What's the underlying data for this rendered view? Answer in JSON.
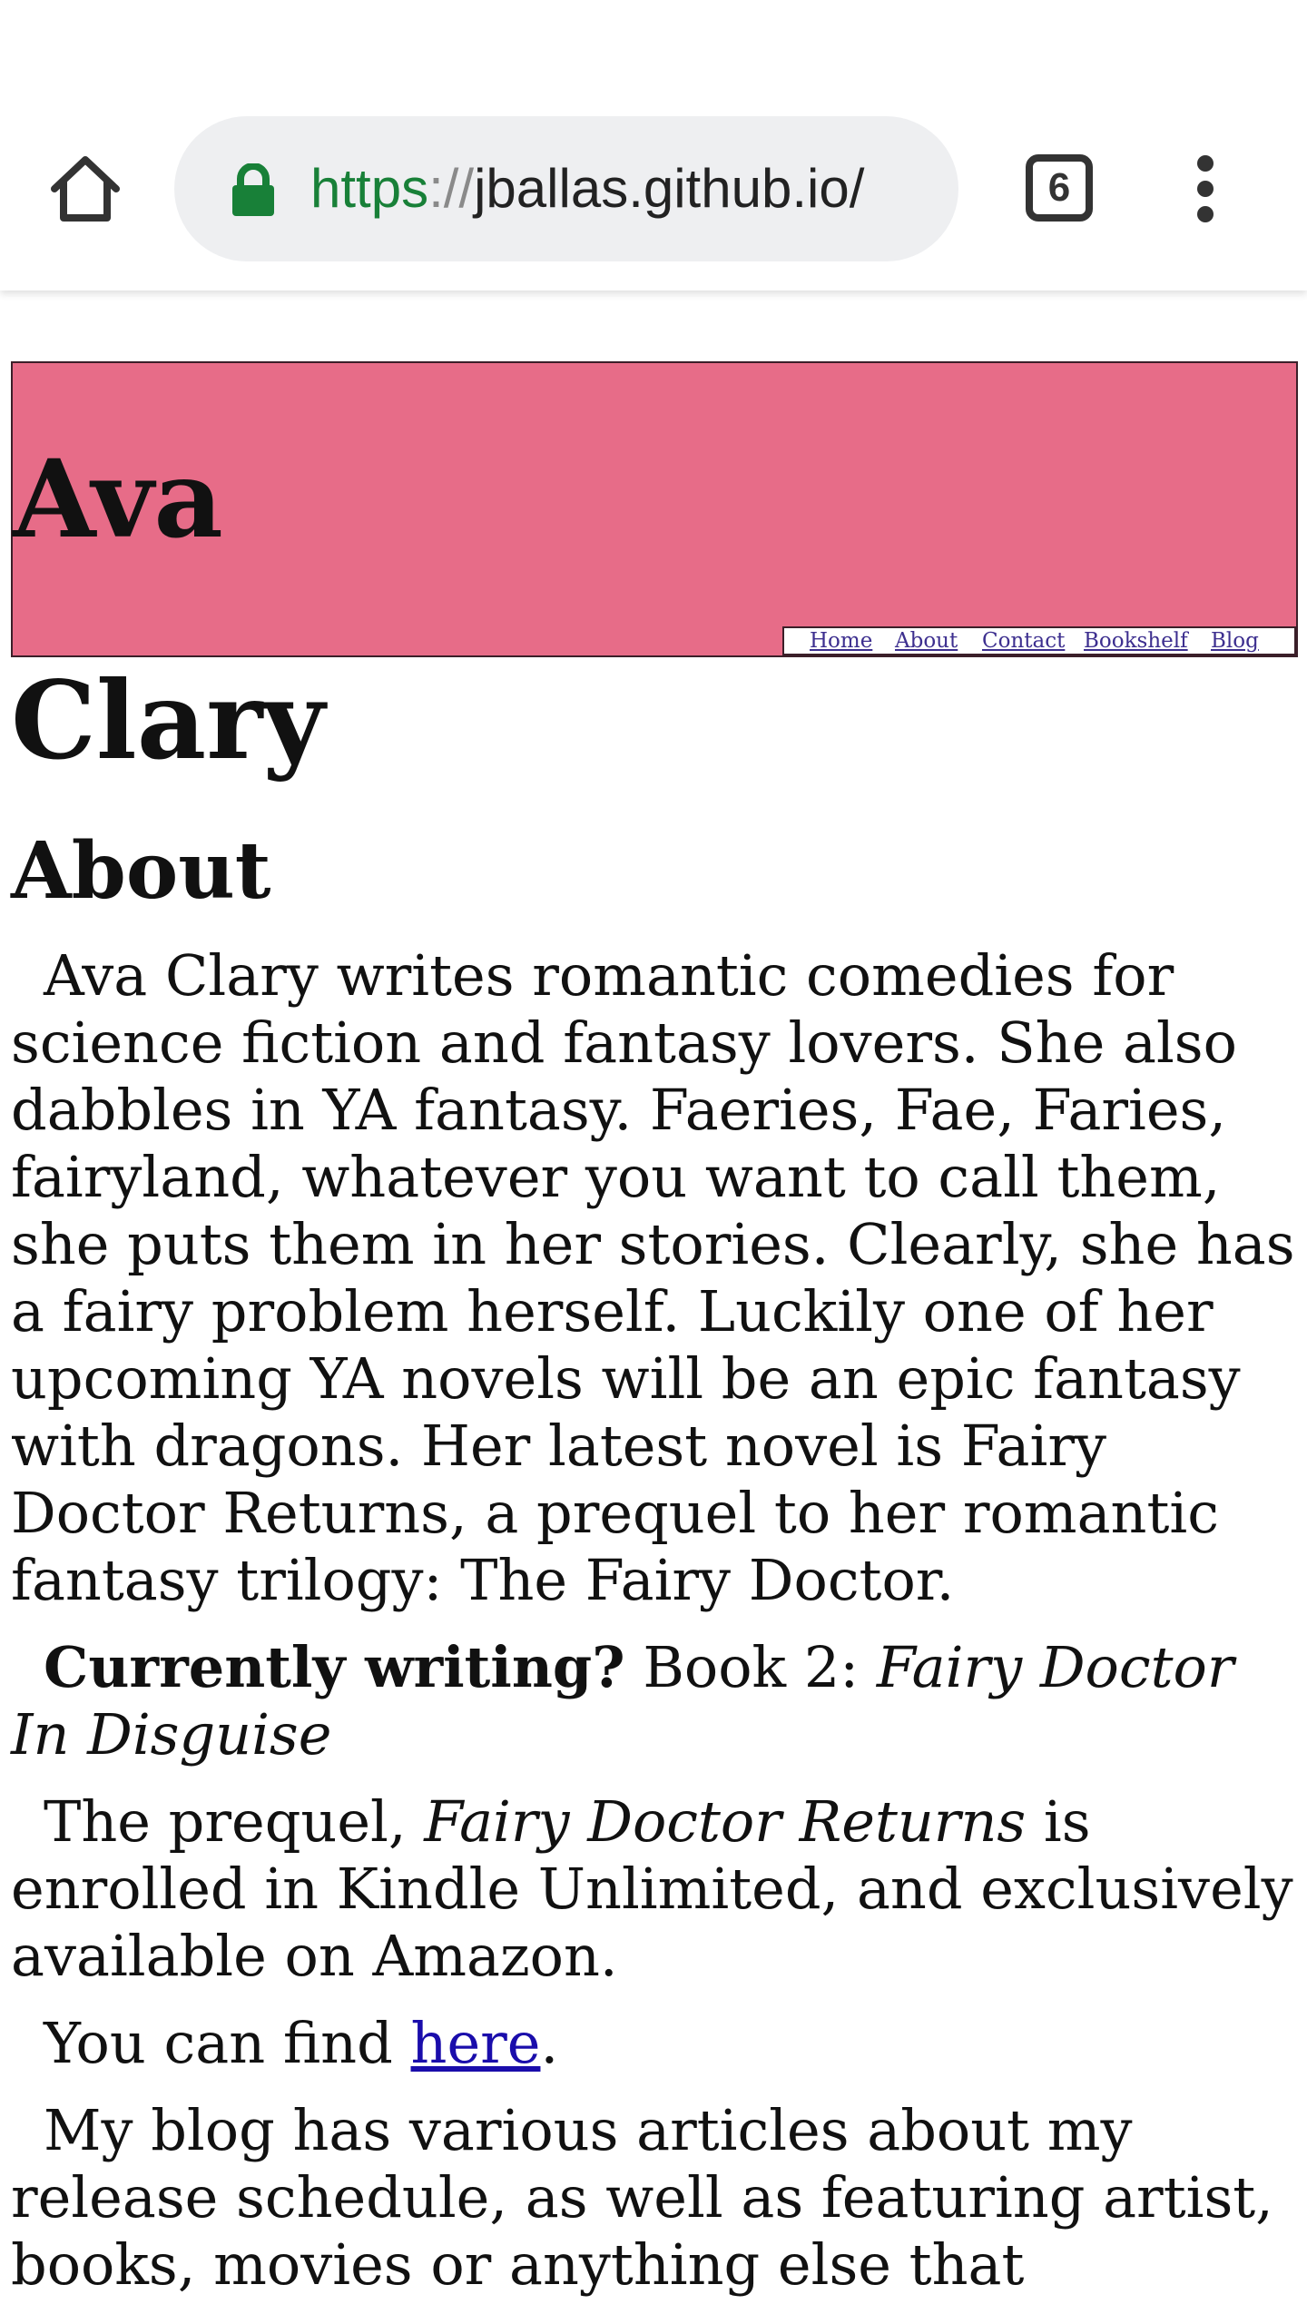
{
  "browser": {
    "url_scheme": "https",
    "url_separator": "://",
    "url_host": "jballas.github.io/",
    "tab_count": "6",
    "icons": {
      "home": "home-icon",
      "lock": "lock-icon",
      "tabs": "tabs-icon",
      "menu": "more-vert-icon"
    },
    "colors": {
      "lock": "#188038",
      "scheme": "#188038"
    }
  },
  "header": {
    "title": "Ava",
    "background_color": "#e76c88",
    "nav": [
      {
        "label": "Home"
      },
      {
        "label": "About"
      },
      {
        "label": "Contact"
      },
      {
        "label": "Bookshelf"
      },
      {
        "label": "Blog"
      }
    ]
  },
  "main": {
    "title_continued": "Clary",
    "section_heading": "About",
    "intro": "Ava Clary writes romantic comedies for science fiction and fantasy lovers. She also dabbles in YA fantasy. Faeries, Fae, Faries, fairyland, whatever you want to call them, she puts them in her stories. Clearly, she has a fairy problem herself. Luckily one of her upcoming YA novels will be an epic fantasy with dragons. Her latest novel is Fairy Doctor Returns, a prequel to her romantic fantasy trilogy: The Fairy Doctor.",
    "currently": {
      "label": "Currently writing?",
      "prefix": " Book 2: ",
      "book": "Fairy Doctor In Disguise"
    },
    "prequel": {
      "prefix": "The prequel, ",
      "book": "Fairy Doctor Returns",
      "suffix": " is enrolled in Kindle Unlimited, and exclusively available on Amazon."
    },
    "find": {
      "prefix": "You can find ",
      "link": "here",
      "suffix": "."
    },
    "blog": "My blog has various articles about my release schedule, as well as featuring artist, books, movies or anything else that"
  }
}
